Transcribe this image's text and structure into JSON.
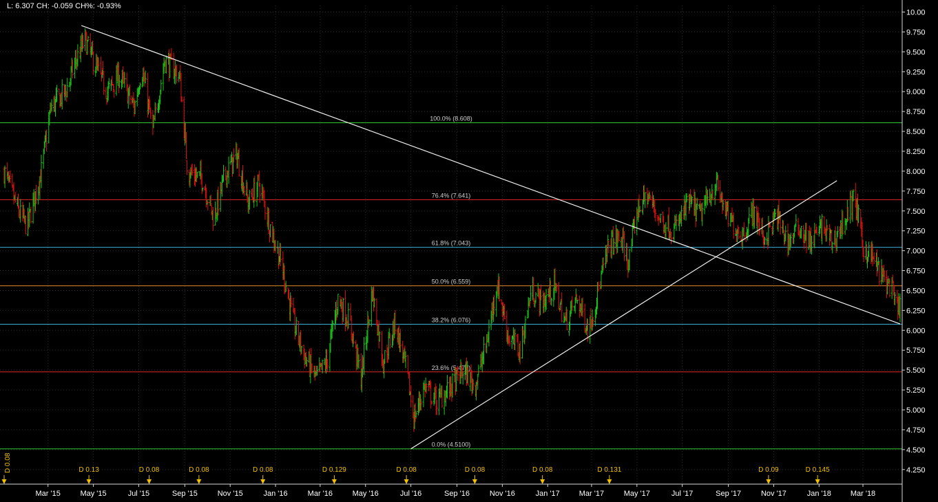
{
  "header": {
    "low_label": "L:",
    "low_value": "6.307",
    "change_label": "CH:",
    "change_value": "-0.059",
    "change_pct_label": "CH%:",
    "change_pct_value": "-0.93%"
  },
  "colors": {
    "background": "#000000",
    "grid": "#2c2c2c",
    "up_bar": "#19c619",
    "down_bar": "#e01010",
    "trendline": "#f0f0f0",
    "dividend_marker": "#f3c000",
    "axis_text": "#ffffff"
  },
  "chart_data": {
    "type": "ohlc",
    "subtype": "price bars with fibonacci retracement and trendlines",
    "x_unit": "date",
    "x_range": [
      "2015-01-01",
      "2018-04-20"
    ],
    "ylim": [
      4.25,
      10.0
    ],
    "y_tick_step": 0.25,
    "y_ticks": [
      "4.250",
      "4.500",
      "4.750",
      "5.000",
      "5.250",
      "5.500",
      "5.750",
      "6.000",
      "6.250",
      "6.500",
      "6.750",
      "7.000",
      "7.250",
      "7.500",
      "7.750",
      "8.000",
      "8.250",
      "8.500",
      "8.750",
      "9.000",
      "9.250",
      "9.500",
      "9.750",
      "10.00"
    ],
    "x_ticks": [
      {
        "label": "Mar '15",
        "date": "2015-03-01"
      },
      {
        "label": "May '15",
        "date": "2015-05-01"
      },
      {
        "label": "Jul '15",
        "date": "2015-07-01"
      },
      {
        "label": "Sep '15",
        "date": "2015-09-01"
      },
      {
        "label": "Nov '15",
        "date": "2015-11-01"
      },
      {
        "label": "Jan '16",
        "date": "2016-01-01"
      },
      {
        "label": "Mar '16",
        "date": "2016-03-01"
      },
      {
        "label": "May '16",
        "date": "2016-05-01"
      },
      {
        "label": "Jul '16",
        "date": "2016-07-01"
      },
      {
        "label": "Sep '16",
        "date": "2016-09-01"
      },
      {
        "label": "Nov '16",
        "date": "2016-11-01"
      },
      {
        "label": "Jan '17",
        "date": "2017-01-01"
      },
      {
        "label": "Mar '17",
        "date": "2017-03-01"
      },
      {
        "label": "May '17",
        "date": "2017-05-01"
      },
      {
        "label": "Jul '17",
        "date": "2017-07-01"
      },
      {
        "label": "Sep '17",
        "date": "2017-09-01"
      },
      {
        "label": "Nov '17",
        "date": "2017-11-01"
      },
      {
        "label": "Jan '18",
        "date": "2018-01-01"
      },
      {
        "label": "Mar '18",
        "date": "2018-03-01"
      }
    ],
    "grid": true,
    "price_path": [
      {
        "date": "2015-01-01",
        "price": 8.0
      },
      {
        "date": "2015-01-20",
        "price": 7.5
      },
      {
        "date": "2015-02-01",
        "price": 7.3
      },
      {
        "date": "2015-02-20",
        "price": 8.0
      },
      {
        "date": "2015-03-05",
        "price": 8.8
      },
      {
        "date": "2015-03-25",
        "price": 9.0
      },
      {
        "date": "2015-04-08",
        "price": 9.4
      },
      {
        "date": "2015-04-20",
        "price": 9.65
      },
      {
        "date": "2015-05-05",
        "price": 9.3
      },
      {
        "date": "2015-05-20",
        "price": 9.0
      },
      {
        "date": "2015-06-05",
        "price": 9.2
      },
      {
        "date": "2015-06-25",
        "price": 8.8
      },
      {
        "date": "2015-07-05",
        "price": 9.3
      },
      {
        "date": "2015-07-20",
        "price": 8.5
      },
      {
        "date": "2015-08-05",
        "price": 9.4
      },
      {
        "date": "2015-08-25",
        "price": 9.2
      },
      {
        "date": "2015-09-05",
        "price": 8.0
      },
      {
        "date": "2015-09-25",
        "price": 7.9
      },
      {
        "date": "2015-10-10",
        "price": 7.4
      },
      {
        "date": "2015-10-25",
        "price": 7.95
      },
      {
        "date": "2015-11-10",
        "price": 8.2
      },
      {
        "date": "2015-11-25",
        "price": 7.6
      },
      {
        "date": "2015-12-10",
        "price": 7.85
      },
      {
        "date": "2015-12-25",
        "price": 7.3
      },
      {
        "date": "2016-01-10",
        "price": 6.8
      },
      {
        "date": "2016-01-25",
        "price": 6.1
      },
      {
        "date": "2016-02-10",
        "price": 5.65
      },
      {
        "date": "2016-02-25",
        "price": 5.4
      },
      {
        "date": "2016-03-10",
        "price": 5.6
      },
      {
        "date": "2016-03-25",
        "price": 6.4
      },
      {
        "date": "2016-04-10",
        "price": 6.1
      },
      {
        "date": "2016-04-25",
        "price": 5.4
      },
      {
        "date": "2016-05-10",
        "price": 6.5
      },
      {
        "date": "2016-05-25",
        "price": 5.6
      },
      {
        "date": "2016-06-10",
        "price": 6.1
      },
      {
        "date": "2016-06-25",
        "price": 5.5
      },
      {
        "date": "2016-07-05",
        "price": 4.9
      },
      {
        "date": "2016-07-20",
        "price": 5.3
      },
      {
        "date": "2016-08-05",
        "price": 5.1
      },
      {
        "date": "2016-08-25",
        "price": 5.3
      },
      {
        "date": "2016-09-10",
        "price": 5.5
      },
      {
        "date": "2016-09-25",
        "price": 5.3
      },
      {
        "date": "2016-10-10",
        "price": 5.8
      },
      {
        "date": "2016-10-25",
        "price": 6.6
      },
      {
        "date": "2016-11-10",
        "price": 5.9
      },
      {
        "date": "2016-11-25",
        "price": 5.75
      },
      {
        "date": "2016-12-10",
        "price": 6.5
      },
      {
        "date": "2016-12-25",
        "price": 6.35
      },
      {
        "date": "2017-01-10",
        "price": 6.55
      },
      {
        "date": "2017-01-25",
        "price": 6.1
      },
      {
        "date": "2017-02-10",
        "price": 6.4
      },
      {
        "date": "2017-02-25",
        "price": 6.0
      },
      {
        "date": "2017-03-10",
        "price": 6.5
      },
      {
        "date": "2017-03-25",
        "price": 7.1
      },
      {
        "date": "2017-04-10",
        "price": 7.15
      },
      {
        "date": "2017-04-20",
        "price": 6.85
      },
      {
        "date": "2017-05-01",
        "price": 7.5
      },
      {
        "date": "2017-05-15",
        "price": 7.7
      },
      {
        "date": "2017-06-01",
        "price": 7.4
      },
      {
        "date": "2017-06-20",
        "price": 7.25
      },
      {
        "date": "2017-07-10",
        "price": 7.6
      },
      {
        "date": "2017-07-25",
        "price": 7.45
      },
      {
        "date": "2017-08-15",
        "price": 7.85
      },
      {
        "date": "2017-09-01",
        "price": 7.4
      },
      {
        "date": "2017-09-20",
        "price": 7.2
      },
      {
        "date": "2017-10-05",
        "price": 7.5
      },
      {
        "date": "2017-10-20",
        "price": 7.15
      },
      {
        "date": "2017-11-05",
        "price": 7.45
      },
      {
        "date": "2017-11-20",
        "price": 7.1
      },
      {
        "date": "2017-12-05",
        "price": 7.3
      },
      {
        "date": "2017-12-20",
        "price": 7.1
      },
      {
        "date": "2018-01-05",
        "price": 7.3
      },
      {
        "date": "2018-01-20",
        "price": 7.1
      },
      {
        "date": "2018-02-05",
        "price": 7.4
      },
      {
        "date": "2018-02-18",
        "price": 7.68
      },
      {
        "date": "2018-03-01",
        "price": 7.05
      },
      {
        "date": "2018-03-15",
        "price": 6.9
      },
      {
        "date": "2018-03-28",
        "price": 6.65
      },
      {
        "date": "2018-04-08",
        "price": 6.55
      },
      {
        "date": "2018-04-15",
        "price": 6.25
      },
      {
        "date": "2018-04-20",
        "price": 6.35
      }
    ],
    "fib_levels": [
      {
        "label": "100.0% (8.608)",
        "value": 8.608,
        "color": "#2fc82f"
      },
      {
        "label": "76.4% (7.641)",
        "value": 7.641,
        "color": "#e02828"
      },
      {
        "label": "61.8% (7.043)",
        "value": 7.043,
        "color": "#3aaed8"
      },
      {
        "label": "50.0% (6.559)",
        "value": 6.559,
        "color": "#e08a28"
      },
      {
        "label": "38.2% (6.076)",
        "value": 6.076,
        "color": "#3aaed8"
      },
      {
        "label": "23.6% (5.477)",
        "value": 5.477,
        "color": "#e02828"
      },
      {
        "label": "0.0% (4.5100)",
        "value": 4.51,
        "color": "#2fc82f"
      }
    ],
    "trendlines": [
      {
        "from": {
          "date": "2015-04-15",
          "price": 9.83
        },
        "to": {
          "date": "2018-04-20",
          "price": 6.08
        }
      },
      {
        "from": {
          "date": "2016-07-01",
          "price": 4.51
        },
        "to": {
          "date": "2018-01-25",
          "price": 7.88
        }
      }
    ],
    "dividends": [
      {
        "label": "D 0.08",
        "date": "2015-01-01",
        "vertical": true
      },
      {
        "label": "D 0.13",
        "date": "2015-04-25"
      },
      {
        "label": "D 0.08",
        "date": "2015-07-15"
      },
      {
        "label": "D 0.08",
        "date": "2015-09-20"
      },
      {
        "label": "D 0.08",
        "date": "2015-12-15"
      },
      {
        "label": "D 0.129",
        "date": "2016-03-20"
      },
      {
        "label": "D 0.08",
        "date": "2016-06-25"
      },
      {
        "label": "D 0.08",
        "date": "2016-09-25"
      },
      {
        "label": "D 0.08",
        "date": "2016-12-25"
      },
      {
        "label": "D 0.131",
        "date": "2017-03-25"
      },
      {
        "label": "D 0.09",
        "date": "2017-10-25"
      },
      {
        "label": "D 0.145",
        "date": "2017-12-30"
      }
    ]
  }
}
